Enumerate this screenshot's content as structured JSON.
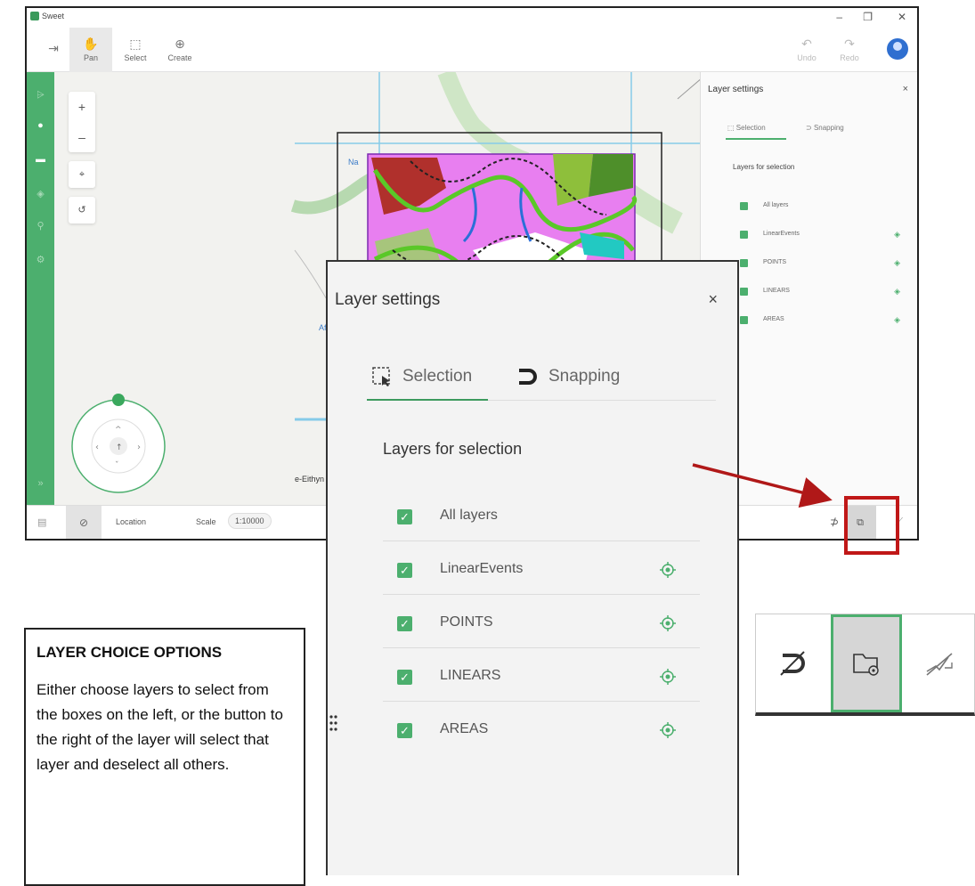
{
  "app": {
    "title": "Sweet",
    "toolbar": {
      "pan_label": "Pan",
      "select_label": "Select",
      "create_label": "Create",
      "undo_label": "Undo",
      "redo_label": "Redo"
    },
    "map": {
      "labels": [
        "Na",
        "Afon",
        "e-Eithyn"
      ]
    },
    "status": {
      "location_label": "Location",
      "scale_label": "Scale",
      "scale_value": "1:10000"
    },
    "side_panel": {
      "title": "Layer settings",
      "tabs": [
        "Selection",
        "Snapping"
      ],
      "subtitle": "Layers for selection",
      "layers": [
        {
          "label": "All layers",
          "checked": true,
          "has_target": false
        },
        {
          "label": "LinearEvents",
          "checked": true,
          "has_target": true
        },
        {
          "label": "POINTS",
          "checked": true,
          "has_target": true
        },
        {
          "label": "LINEARS",
          "checked": true,
          "has_target": true
        },
        {
          "label": "AREAS",
          "checked": true,
          "has_target": true
        }
      ]
    }
  },
  "zoom_panel": {
    "title": "Layer settings",
    "close": "×",
    "tabs": [
      {
        "label": "Selection",
        "active": true,
        "icon": "selection-icon"
      },
      {
        "label": "Snapping",
        "active": false,
        "icon": "magnet-icon"
      }
    ],
    "subtitle": "Layers for selection",
    "layers": [
      {
        "label": "All layers",
        "checked": true,
        "has_target": false
      },
      {
        "label": "LinearEvents",
        "checked": true,
        "has_target": true
      },
      {
        "label": "POINTS",
        "checked": true,
        "has_target": true
      },
      {
        "label": "LINEARS",
        "checked": true,
        "has_target": true
      },
      {
        "label": "AREAS",
        "checked": true,
        "has_target": true
      }
    ]
  },
  "callout": {
    "title": "LAYER CHOICE OPTIONS",
    "body": "Either choose layers to select from the boxes on the left, or the button to the right of the layer will select that layer and deselect all others."
  },
  "inset": {
    "buttons": [
      {
        "icon": "snapping-off-icon",
        "active": false
      },
      {
        "icon": "layer-selection-icon",
        "active": true
      },
      {
        "icon": "tracing-off-icon",
        "active": false
      }
    ]
  },
  "colors": {
    "accent": "#4caf6e",
    "highlight": "#c01818",
    "map_magenta": "#e87ff0"
  }
}
